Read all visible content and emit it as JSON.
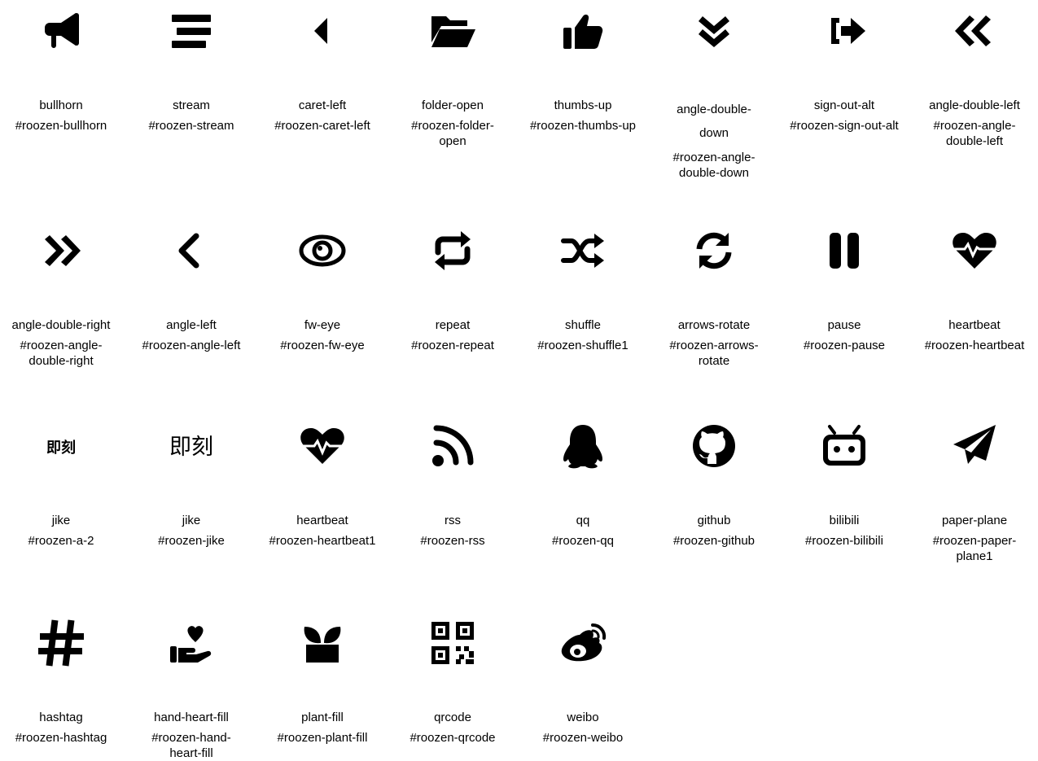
{
  "icons": [
    {
      "name": "bullhorn",
      "code": "#roozen-bullhorn",
      "icon": "bullhorn-icon"
    },
    {
      "name": "stream",
      "code": "#roozen-stream",
      "icon": "stream-icon"
    },
    {
      "name": "caret-left",
      "code": "#roozen-caret-left",
      "icon": "caret-left-icon"
    },
    {
      "name": "folder-open",
      "code": "#roozen-folder-open",
      "icon": "folder-open-icon"
    },
    {
      "name": "thumbs-up",
      "code": "#roozen-thumbs-up",
      "icon": "thumbs-up-icon"
    },
    {
      "name": "angle-double-down",
      "code": "#roozen-angle-double-down",
      "icon": "angle-double-down-icon"
    },
    {
      "name": "sign-out-alt",
      "code": "#roozen-sign-out-alt",
      "icon": "sign-out-alt-icon"
    },
    {
      "name": "angle-double-left",
      "code": "#roozen-angle-double-left",
      "icon": "angle-double-left-icon"
    },
    {
      "name": "angle-double-right",
      "code": "#roozen-angle-double-right",
      "icon": "angle-double-right-icon"
    },
    {
      "name": "angle-left",
      "code": "#roozen-angle-left",
      "icon": "angle-left-icon"
    },
    {
      "name": "fw-eye",
      "code": "#roozen-fw-eye",
      "icon": "eye-icon"
    },
    {
      "name": "repeat",
      "code": "#roozen-repeat",
      "icon": "repeat-icon"
    },
    {
      "name": "shuffle",
      "code": "#roozen-shuffle1",
      "icon": "shuffle-icon"
    },
    {
      "name": "arrows-rotate",
      "code": "#roozen-arrows-rotate",
      "icon": "arrows-rotate-icon"
    },
    {
      "name": "pause",
      "code": "#roozen-pause",
      "icon": "pause-icon"
    },
    {
      "name": "heartbeat",
      "code": "#roozen-heartbeat",
      "icon": "heartbeat-icon"
    },
    {
      "name": "jike",
      "code": "#roozen-a-2",
      "icon": "jike-bold-icon"
    },
    {
      "name": "jike",
      "code": "#roozen-jike",
      "icon": "jike-outline-icon"
    },
    {
      "name": "heartbeat",
      "code": "#roozen-heartbeat1",
      "icon": "heartbeat-alt-icon"
    },
    {
      "name": "rss",
      "code": "#roozen-rss",
      "icon": "rss-icon"
    },
    {
      "name": "qq",
      "code": "#roozen-qq",
      "icon": "qq-icon"
    },
    {
      "name": "github",
      "code": "#roozen-github",
      "icon": "github-icon"
    },
    {
      "name": "bilibili",
      "code": "#roozen-bilibili",
      "icon": "bilibili-icon"
    },
    {
      "name": "paper-plane",
      "code": "#roozen-paper-plane1",
      "icon": "paper-plane-icon"
    },
    {
      "name": "hashtag",
      "code": "#roozen-hashtag",
      "icon": "hashtag-icon"
    },
    {
      "name": "hand-heart-fill",
      "code": "#roozen-hand-heart-fill",
      "icon": "hand-heart-icon"
    },
    {
      "name": "plant-fill",
      "code": "#roozen-plant-fill",
      "icon": "plant-icon"
    },
    {
      "name": "qrcode",
      "code": "#roozen-qrcode",
      "icon": "qrcode-icon"
    },
    {
      "name": "weibo",
      "code": "#roozen-weibo",
      "icon": "weibo-icon"
    }
  ],
  "jike_glyph": "即刻"
}
